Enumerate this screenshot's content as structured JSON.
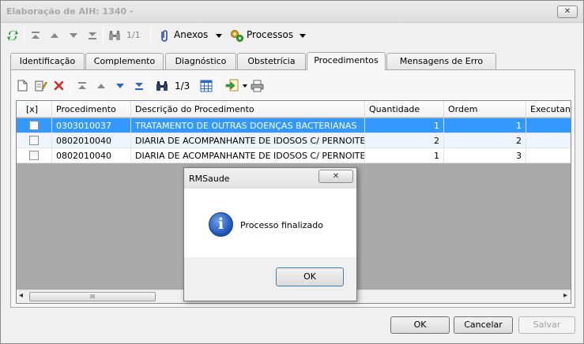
{
  "window": {
    "title": "Elaboração de AIH: 1340 -",
    "close_glyph": "✕"
  },
  "toolbar": {
    "record_position": "1/1",
    "anexos_label": "Anexos",
    "processos_label": "Processos"
  },
  "tabs": [
    {
      "label": "Identificação"
    },
    {
      "label": "Complemento"
    },
    {
      "label": "Diagnóstico"
    },
    {
      "label": "Obstetrícia"
    },
    {
      "label": "Procedimentos"
    },
    {
      "label": "Mensagens de Erro"
    }
  ],
  "active_tab": "Procedimentos",
  "inner_toolbar": {
    "record_position": "1/3"
  },
  "grid": {
    "columns": [
      "[x]",
      "Procedimento",
      "Descrição do Procedimento",
      "Quantidade",
      "Ordem",
      "Executante"
    ],
    "rows": [
      {
        "procedimento": "0303010037",
        "descricao": "TRATAMENTO DE OUTRAS DOENÇAS BACTERIANAS",
        "quantidade": "1",
        "ordem": "1"
      },
      {
        "procedimento": "0802010040",
        "descricao": "DIARIA DE ACOMPANHANTE DE IDOSOS C/ PERNOITE",
        "quantidade": "2",
        "ordem": "2"
      },
      {
        "procedimento": "0802010040",
        "descricao": "DIARIA DE ACOMPANHANTE DE IDOSOS C/ PERNOITE",
        "quantidade": "1",
        "ordem": "3"
      }
    ],
    "scroll_left": "◂",
    "scroll_right": "▸",
    "thumb_grip": "III"
  },
  "footer": {
    "ok_label": "OK",
    "cancel_label": "Cancelar",
    "save_label": "Salvar"
  },
  "dialog": {
    "title": "RMSaude",
    "message": "Processo finalizado",
    "ok_label": "OK",
    "close_glyph": "✕",
    "icon_glyph": "i"
  },
  "colors": {
    "selection": "#3399ff",
    "title_text": "#a9a9a9"
  }
}
